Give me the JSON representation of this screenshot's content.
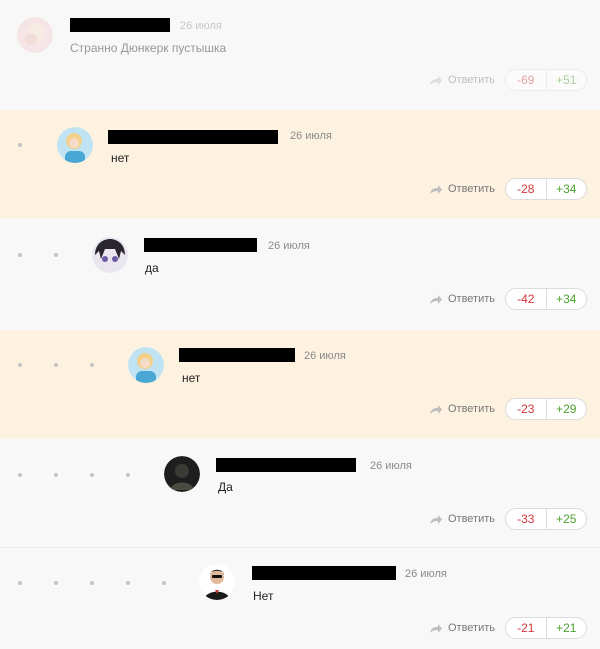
{
  "comments": [
    {
      "date": "26 июля",
      "text": "Странно Дюнкерк пустышка",
      "reply": "Ответить",
      "minus": "-69",
      "plus": "+51"
    },
    {
      "date": "26 июля",
      "text": "нет",
      "reply": "Ответить",
      "minus": "-28",
      "plus": "+34"
    },
    {
      "date": "26 июля",
      "text": "да",
      "reply": "Ответить",
      "minus": "-42",
      "plus": "+34"
    },
    {
      "date": "26 июля",
      "text": "нет",
      "reply": "Ответить",
      "minus": "-23",
      "plus": "+29"
    },
    {
      "date": "26 июля",
      "text": "Да",
      "reply": "Ответить",
      "minus": "-33",
      "plus": "+25"
    },
    {
      "date": "26 июля",
      "text": "Нет",
      "reply": "Ответить",
      "minus": "-21",
      "plus": "+21"
    }
  ],
  "colors": {
    "highlight_bg": "#fdf2e0",
    "minus": "#d4363a",
    "plus": "#4da12f"
  }
}
